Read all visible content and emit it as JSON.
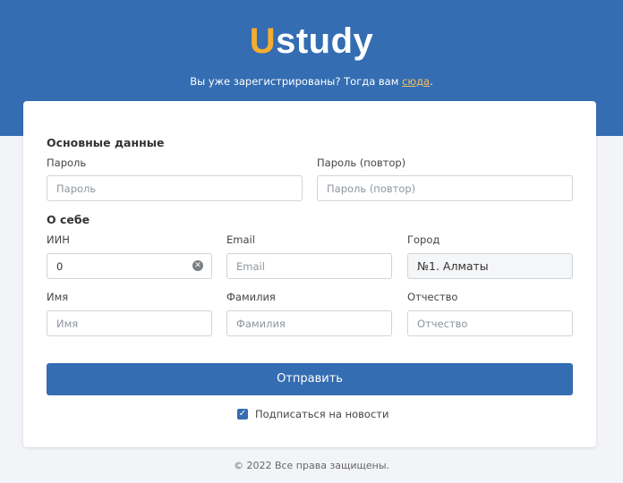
{
  "header": {
    "logo_first": "U",
    "logo_rest": "study",
    "tagline_text": "Вы уже зарегистрированы? Тогда вам ",
    "tagline_link": "сюда",
    "tagline_end": "."
  },
  "form": {
    "basic": {
      "title": "Основные данные",
      "password_label": "Пароль",
      "password_placeholder": "Пароль",
      "password_repeat_label": "Пароль (повтор)",
      "password_repeat_placeholder": "Пароль (повтор)"
    },
    "about": {
      "title": "О себе",
      "iin_label": "ИИН",
      "iin_value": "0",
      "email_label": "Email",
      "email_placeholder": "Email",
      "city_label": "Город",
      "city_value": "№1. Алматы",
      "name_label": "Имя",
      "name_placeholder": "Имя",
      "surname_label": "Фамилия",
      "surname_placeholder": "Фамилия",
      "patronymic_label": "Отчество",
      "patronymic_placeholder": "Отчество"
    },
    "submit_label": "Отправить",
    "subscribe_label": "Подписаться на новости",
    "subscribe_checked": true
  },
  "footer": {
    "copyright": "© 2022 Все права защищены."
  },
  "colors": {
    "brand_blue": "#346db2",
    "logo_accent": "#f4ad2f"
  }
}
